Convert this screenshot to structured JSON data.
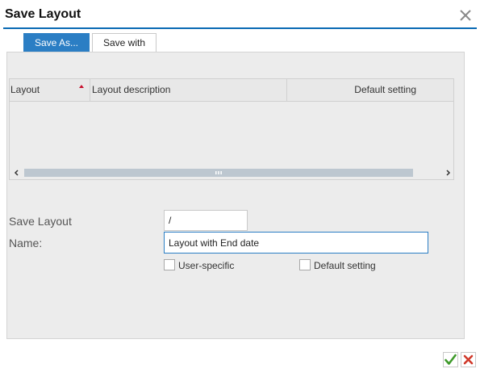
{
  "dialog": {
    "title": "Save Layout",
    "accent_color": "#0a6ab4"
  },
  "tabs": [
    {
      "label": "Save As...",
      "active": true
    },
    {
      "label": "Save with",
      "active": false
    }
  ],
  "table": {
    "columns": [
      "Layout",
      "Layout description",
      "Default setting"
    ],
    "sort_column": "Layout",
    "rows": []
  },
  "form": {
    "save_layout_label": "Save Layout",
    "save_layout_value": "/",
    "name_label": "Name:",
    "name_value": "Layout with End date",
    "user_specific_label": "User-specific",
    "user_specific_checked": false,
    "default_setting_label": "Default setting",
    "default_setting_checked": false
  },
  "footer": {
    "ok_icon": "check-icon",
    "cancel_icon": "cancel-x-icon"
  }
}
